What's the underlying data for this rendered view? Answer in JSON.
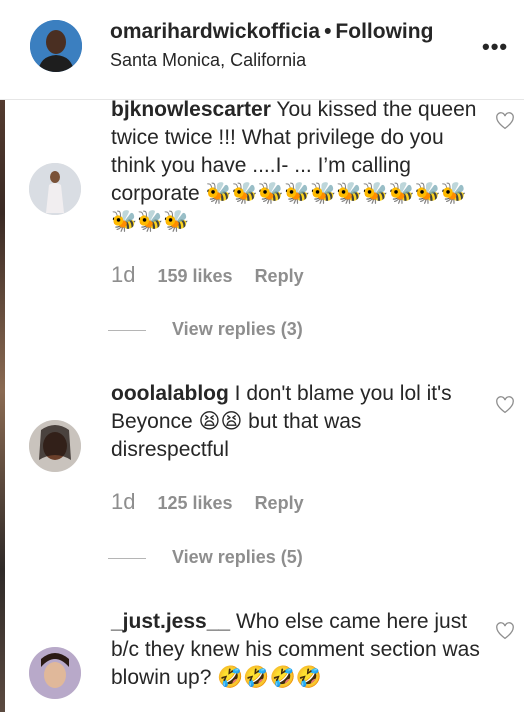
{
  "header": {
    "username": "omarihardwickofficia",
    "separator": "•",
    "follow_status": "Following",
    "location": "Santa Monica, California",
    "more_label": "•••"
  },
  "comments": [
    {
      "username": "bjknowlescarter",
      "text": "You kissed the queen twice twice !!! What privilege do you think you have ....I- ... I’m calling corporate 🐝🐝🐝🐝🐝🐝🐝🐝🐝🐝🐝🐝🐝",
      "time": "1d",
      "likes": "159 likes",
      "reply": "Reply",
      "view_replies": "View replies (3)"
    },
    {
      "username": "ooolalablog",
      "text": "I don't blame you lol it's Beyonce 😫😫 but that was disrespectful",
      "time": "1d",
      "likes": "125 likes",
      "reply": "Reply",
      "view_replies": "View replies (5)"
    },
    {
      "username": "_just.jess__",
      "text": "Who else came here just b/c they knew his comment section was blowin up? 🤣🤣🤣🤣"
    }
  ],
  "icons": {
    "heart": "heart-outline-icon",
    "more": "more-options-icon"
  },
  "colors": {
    "text": "#262626",
    "secondary": "#8e8e8e",
    "divider": "#e6e6e6"
  }
}
